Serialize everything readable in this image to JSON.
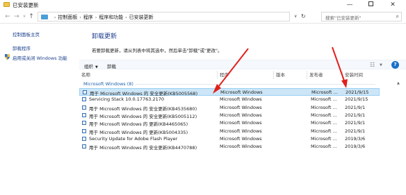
{
  "window": {
    "title": "已安装更新",
    "min_glyph": "—",
    "close_glyph": "✕"
  },
  "nav": {
    "back_glyph": "←",
    "forward_glyph": "→",
    "recent_glyph": "∨",
    "up_glyph": "↑",
    "breadcrumbs": [
      "控制面板",
      "程序",
      "程序和功能",
      "已安装更新"
    ],
    "sep_glyph": "›",
    "dropdown_glyph": "∨",
    "refresh_glyph": "↻",
    "search_placeholder": "搜索\"已安装更新\"",
    "search_glyph": "⌕"
  },
  "left_pane": {
    "home_link": "控制面板主页",
    "uninstall_link": "卸载程序",
    "features_link": "启用或关闭 Windows 功能"
  },
  "main": {
    "heading": "卸载更新",
    "description": "若要卸载更新，请从列表中将其选中，然后单击\"卸载\"或\"更改\"。"
  },
  "toolbar": {
    "organize_label": "组织",
    "organize_caret": "▼",
    "uninstall_label": "卸载",
    "view_glyph": "☷",
    "view_dd_glyph": "▼",
    "help_glyph": "?"
  },
  "columns": {
    "name": "名称",
    "program": "程序",
    "version": "版本",
    "publisher": "发布者",
    "installed_on": "安装时间"
  },
  "group": {
    "label": "Microsoft Windows (8)",
    "scroll_glyph": "▲"
  },
  "rows": [
    {
      "name": "用于 Microsoft Windows 的 安全更新(KB5005568)",
      "program": "Microsoft Windows",
      "publisher": "Microsoft ...",
      "date": "2021/9/15",
      "selected": true
    },
    {
      "name": "Servicing Stack 10.0.17763.2170",
      "program": "Microsoft Windows",
      "publisher": "Microsoft ...",
      "date": "2021/9/15",
      "selected": false
    },
    {
      "name": "用于 Microsoft Windows 的 安全更新(KB4535680)",
      "program": "Microsoft Windows",
      "publisher": "Microsoft ...",
      "date": "2021/9/1",
      "selected": false
    },
    {
      "name": "用于 Microsoft Windows 的 安全更新(KB5005112)",
      "program": "Microsoft Windows",
      "publisher": "Microsoft ...",
      "date": "2021/9/1",
      "selected": false
    },
    {
      "name": "用于 Microsoft Windows 的 更新(KB4465065)",
      "program": "Microsoft Windows",
      "publisher": "Microsoft ...",
      "date": "2021/9/1",
      "selected": false
    },
    {
      "name": "用于 Microsoft Windows 的 更新(KB5004335)",
      "program": "Microsoft Windows",
      "publisher": "Microsoft ...",
      "date": "2021/9/1",
      "selected": false
    },
    {
      "name": "Security Update for Adobe Flash Player",
      "program": "Microsoft Windows",
      "publisher": "Microsoft ...",
      "date": "2019/3/6",
      "selected": false
    },
    {
      "name": "用于 Microsoft Windows 的 安全更新(KB4470788)",
      "program": "Microsoft Windows",
      "publisher": "Microsoft ...",
      "date": "2019/3/6",
      "selected": false
    }
  ],
  "colors": {
    "accent": "#1e3d8f",
    "selection": "#cde6f7",
    "annotation_arrow": "#e0201c"
  }
}
